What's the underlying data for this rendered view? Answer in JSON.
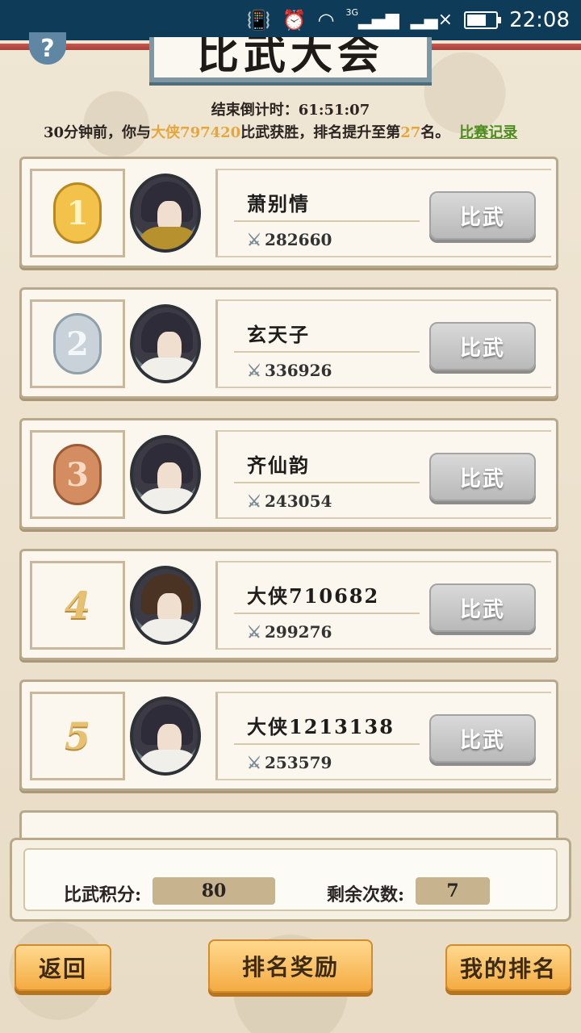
{
  "status_bar": {
    "network": "3G",
    "time": "22:08"
  },
  "header": {
    "title": "比武大会",
    "help_label": "?"
  },
  "countdown": {
    "label": "结束倒计时：",
    "value": "61:51:07"
  },
  "notice": {
    "prefix": "30分钟前，你与",
    "opponent": "大侠797420",
    "middle": "比武获胜，排名提升至第",
    "rank": "27",
    "suffix": "名。",
    "link_label": "比赛记录"
  },
  "players": [
    {
      "rank": "1",
      "medal": "gold",
      "name": "萧别情",
      "power": "282660",
      "button": "比武"
    },
    {
      "rank": "2",
      "medal": "silver",
      "name": "玄天子",
      "power": "336926",
      "button": "比武"
    },
    {
      "rank": "3",
      "medal": "bronze",
      "name": "齐仙韵",
      "power": "243054",
      "button": "比武"
    },
    {
      "rank": "4",
      "medal": "",
      "name": "大侠710682",
      "power": "299276",
      "button": "比武"
    },
    {
      "rank": "5",
      "medal": "",
      "name": "大侠1213138",
      "power": "253579",
      "button": "比武"
    }
  ],
  "score_panel": {
    "points_label": "比武积分:",
    "points_value": "80",
    "remaining_label": "剩余次数:",
    "remaining_value": "7"
  },
  "bottom_bar": {
    "back_label": "返回",
    "rewards_label": "排名奖励",
    "my_rank_label": "我的排名"
  },
  "colors": {
    "status_bar": "#0e3b57",
    "highlight": "#e7a63c",
    "link": "#4d8d1e",
    "button_orange": "#f4ab43",
    "button_gray": "#b9b9b9"
  }
}
